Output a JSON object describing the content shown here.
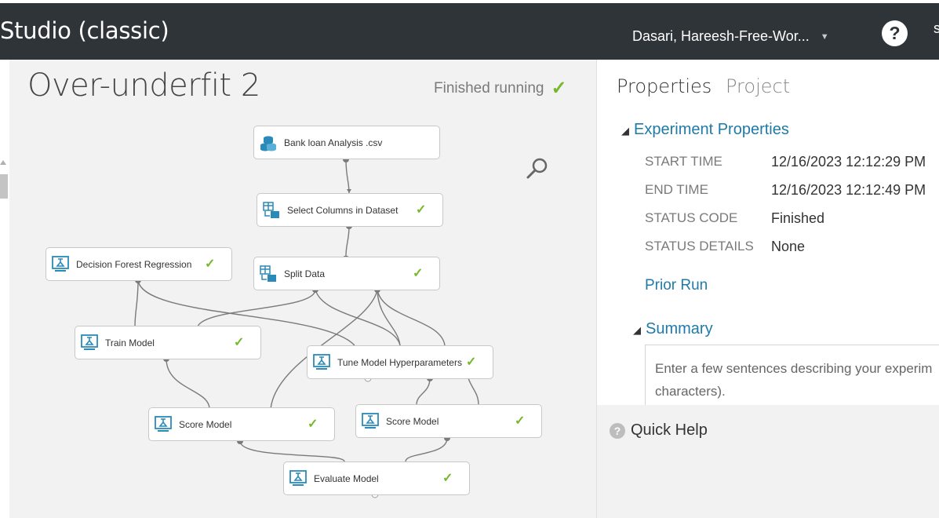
{
  "header": {
    "app_title": "Studio (classic)",
    "user_name": "Dasari, Hareesh-Free-Wor...",
    "caret_icon": "chevron-down-icon",
    "help_label": "?"
  },
  "experiment": {
    "title": "Over-underfit 2",
    "status_text": "Finished running",
    "status_check": "✓"
  },
  "modules": [
    {
      "label": "Bank loan Analysis .csv",
      "icon": "dataset-icon",
      "checked": false
    },
    {
      "label": "Select Columns in Dataset",
      "icon": "table-transform-icon",
      "checked": true
    },
    {
      "label": "Decision Forest Regression",
      "icon": "model-icon",
      "checked": true
    },
    {
      "label": "Split Data",
      "icon": "table-transform-icon",
      "checked": true
    },
    {
      "label": "Train Model",
      "icon": "model-icon",
      "checked": true
    },
    {
      "label": "Tune Model Hyperparameters",
      "icon": "model-icon",
      "checked": true
    },
    {
      "label": "Score Model",
      "icon": "model-icon",
      "checked": true
    },
    {
      "label": "Score Model",
      "icon": "model-icon",
      "checked": true
    },
    {
      "label": "Evaluate Model",
      "icon": "model-icon",
      "checked": true
    }
  ],
  "check_glyph": "✓",
  "properties": {
    "tab_properties": "Properties",
    "tab_project": "Project",
    "section_experiment": "Experiment Properties",
    "section_summary": "Summary",
    "collapse_glyph": "◢",
    "rows": [
      {
        "label": "START TIME",
        "value": "12/16/2023 12:12:29 PM"
      },
      {
        "label": "END TIME",
        "value": "12/16/2023 12:12:49 PM"
      },
      {
        "label": "STATUS CODE",
        "value": "Finished"
      },
      {
        "label": "STATUS DETAILS",
        "value": "None"
      }
    ],
    "prior_run": "Prior Run",
    "summary_line1": "Enter a few sentences describing your experim",
    "summary_line2": "characters)."
  },
  "quick_help": {
    "label": "Quick Help",
    "icon_glyph": "?"
  },
  "colors": {
    "header_bg": "#2f3438",
    "accent_blue": "#1e7ba8",
    "check_green": "#76b82a",
    "canvas_bg": "#f2f2f2",
    "module_icon": "#2a8ab8"
  }
}
